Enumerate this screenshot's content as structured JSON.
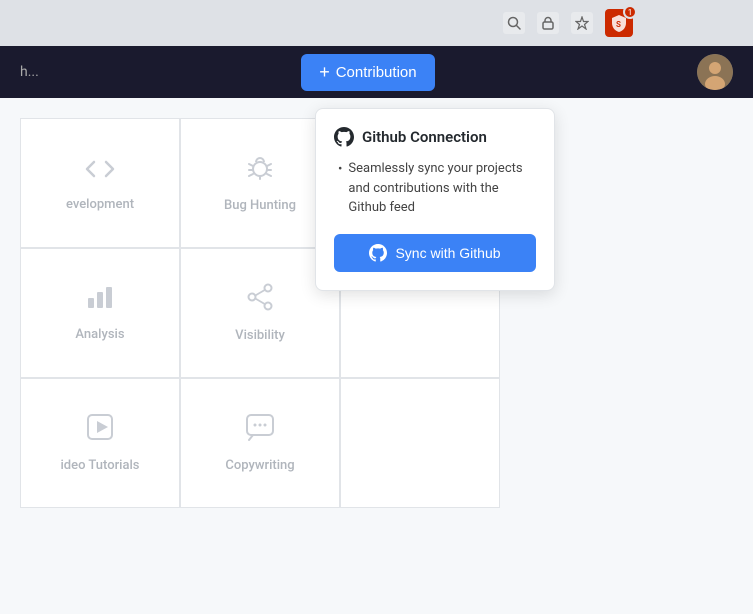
{
  "browser": {
    "shield_badge": "1"
  },
  "header": {
    "app_name": "h...",
    "contribution_label": "Contribution",
    "plus_symbol": "+"
  },
  "popup": {
    "title": "Github Connection",
    "bullet_text": "Seamlessly sync your projects and contributions with the Github feed",
    "sync_button_label": "Sync with Github"
  },
  "cards": [
    {
      "icon": "code",
      "label": "evelopment"
    },
    {
      "icon": "bug",
      "label": "Bug Hunting"
    },
    {
      "icon": "",
      "label": ""
    },
    {
      "icon": "bar_chart",
      "label": "Analysis"
    },
    {
      "icon": "share",
      "label": "Visibility"
    },
    {
      "icon": "",
      "label": ""
    },
    {
      "icon": "play",
      "label": "ideo Tutorials"
    },
    {
      "icon": "chat",
      "label": "Copywriting"
    },
    {
      "icon": "",
      "label": ""
    }
  ]
}
